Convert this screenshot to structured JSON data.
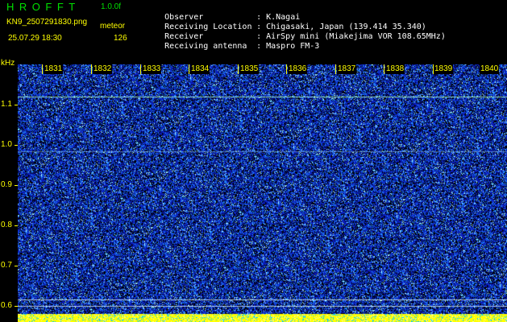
{
  "app": {
    "title": "HROFFT",
    "version": "1.0.0f"
  },
  "file": {
    "name": "KN9_2507291830.png",
    "mode": "meteor",
    "datetime": "25.07.29 18:30",
    "count": "126"
  },
  "info": [
    {
      "label": "Observer",
      "sep": ":",
      "value": "K.Nagai"
    },
    {
      "label": "Receiving Location",
      "sep": ":",
      "value": "Chigasaki, Japan (139.414 35.340)"
    },
    {
      "label": "Receiver",
      "sep": ":",
      "value": "AirSpy mini (Miakejima VOR 108.65MHz)"
    },
    {
      "label": "Receiving antenna",
      "sep": ":",
      "value": "Maspro FM-3"
    }
  ],
  "y_axis": {
    "unit": "kHz",
    "ticks": [
      "1.1",
      "1.0",
      "0.9",
      "0.8",
      "0.7",
      "0.6"
    ]
  },
  "x_axis": {
    "ticks": [
      "1831",
      "1832",
      "1833",
      "1834",
      "1835",
      "1836",
      "1837",
      "1838",
      "1839",
      "1840"
    ]
  },
  "colors": {
    "background": "#000000",
    "label": "#ffff00",
    "info_text": "#ffffff",
    "title": "#00e000",
    "spectrum_base": "#0a1ab4",
    "spectrum_noise": "#1e8cff",
    "spectrum_hot": "#c8ffff",
    "bottom_strip": "#ffff00"
  }
}
